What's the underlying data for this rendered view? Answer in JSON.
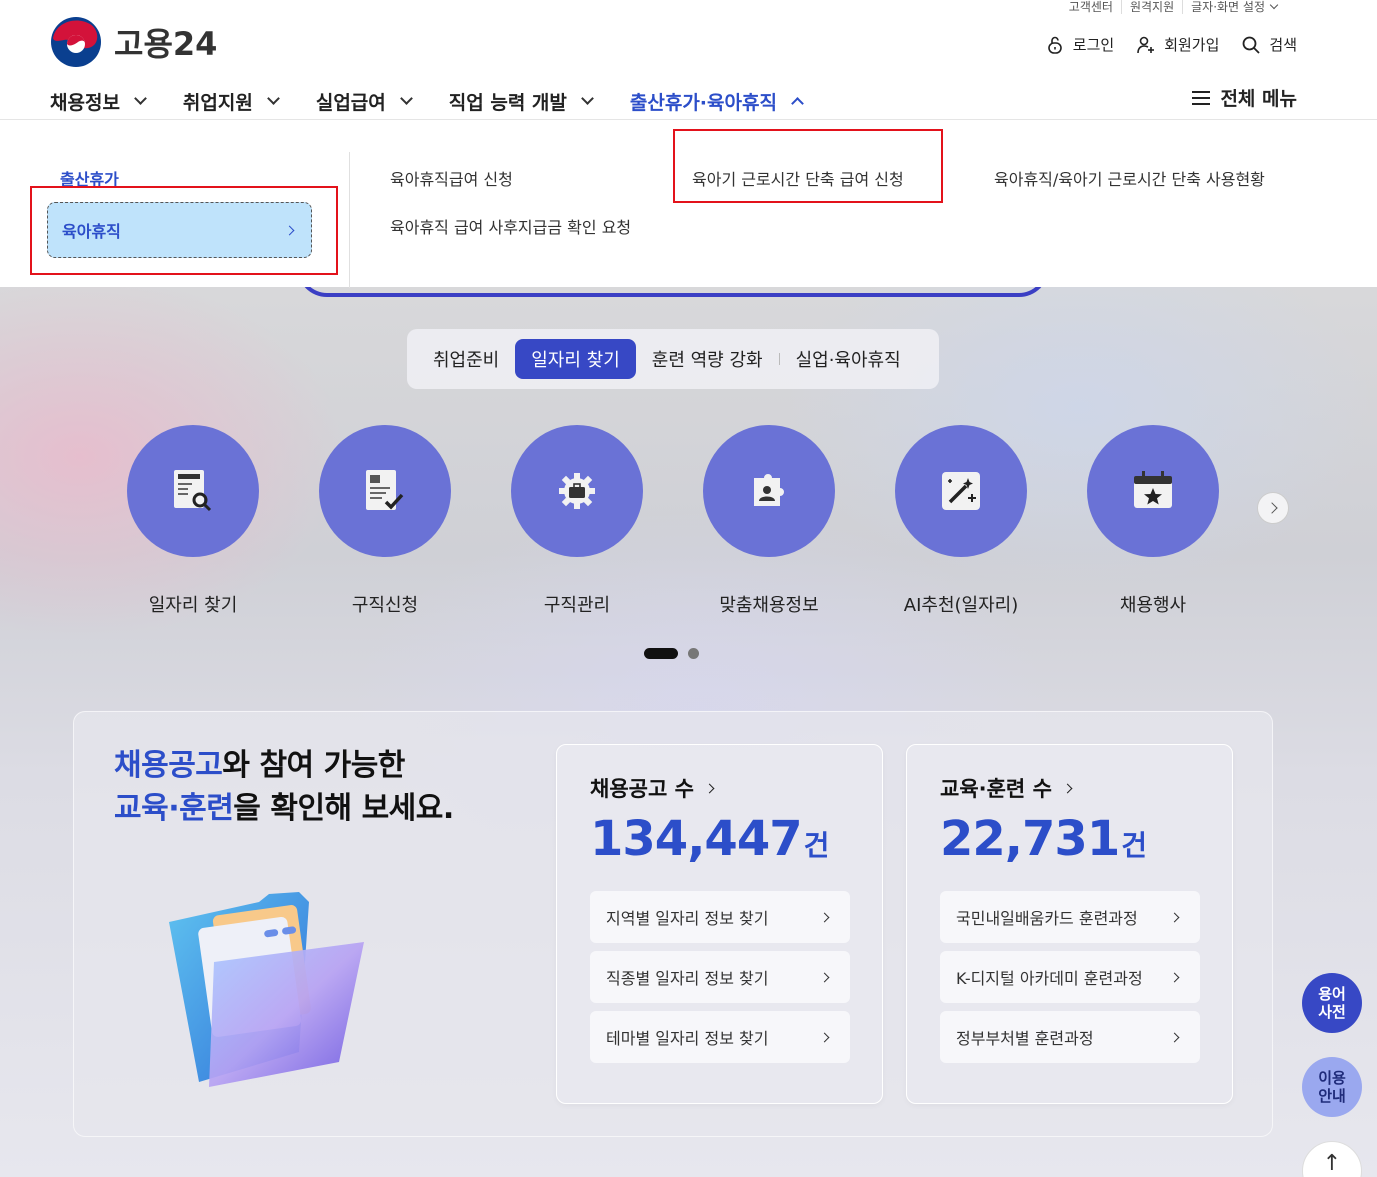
{
  "utility": [
    "고객센터",
    "원격지원",
    "글자·화면 설정"
  ],
  "logo": {
    "text": "고용24"
  },
  "account": {
    "login": "로그인",
    "signup": "회원가입",
    "search": "검색"
  },
  "gnb": [
    {
      "label": "채용정보"
    },
    {
      "label": "취업지원"
    },
    {
      "label": "실업급여"
    },
    {
      "label": "직업 능력 개발"
    },
    {
      "label": "출산휴가·육아휴직"
    }
  ],
  "allmenu": "전체 메뉴",
  "dropdown": {
    "left_items": [
      "출산휴가",
      "육아휴직"
    ],
    "links": [
      "육아휴직급여 신청",
      "육아기 근로시간 단축 급여 신청",
      "육아휴직/육아기 근로시간 단축 사용현황",
      "육아휴직 급여 사후지급금 확인 요청"
    ]
  },
  "tabs": [
    "취업준비",
    "일자리 찾기",
    "훈련 역량 강화",
    "실업·육아휴직"
  ],
  "services": [
    "일자리 찾기",
    "구직신청",
    "구직관리",
    "맞춤채용정보",
    "AI추천(일자리)",
    "채용행사"
  ],
  "headline": {
    "line1_hl": "채용공고",
    "line1_rest": "와 참여 가능한",
    "line2_hl": "교육·훈련",
    "line2_rest": "을 확인해 보세요."
  },
  "stats": [
    {
      "title": "채용공고 수",
      "value": "134,447",
      "unit": "건",
      "buttons": [
        "지역별 일자리 정보 찾기",
        "직종별 일자리 정보 찾기",
        "테마별 일자리 정보 찾기"
      ]
    },
    {
      "title": "교육·훈련 수",
      "value": "22,731",
      "unit": "건",
      "buttons": [
        "국민내일배움카드 훈련과정",
        "K-디지털 아카데미 훈련과정",
        "정부부처별 훈련과정"
      ]
    }
  ],
  "floating": {
    "glossary_1": "용어",
    "glossary_2": "사전",
    "guide_1": "이용",
    "guide_2": "안내",
    "top": "↑"
  },
  "colors": {
    "primary": "#2c4ec9",
    "circle": "#6a72d6",
    "highlight_box": "#e3121b"
  }
}
